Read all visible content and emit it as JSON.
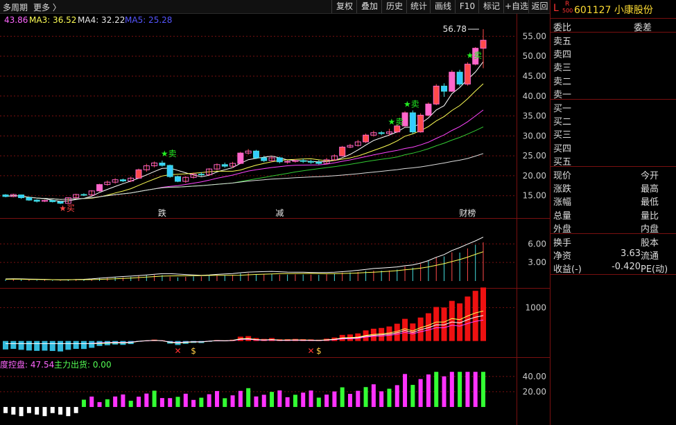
{
  "toolbar": {
    "period": "多周期",
    "more": "更多 〉",
    "buttons": [
      "复权",
      "叠加",
      "历史",
      "统计",
      "画线",
      "F10",
      "标记",
      "+自选",
      "返回"
    ]
  },
  "ma_legend": [
    {
      "label": "43.86",
      "color": "#ff66ff"
    },
    {
      "label": "MA3: 36.52",
      "color": "#ffff55"
    },
    {
      "label": "MA4: 32.22",
      "color": "#e6e6e6"
    },
    {
      "label": "MA5: 25.28",
      "color": "#5555ff"
    }
  ],
  "stock": {
    "market": "L",
    "badge_top": "R",
    "badge_bottom": "500",
    "code_name": "601127 小康股份"
  },
  "quote": {
    "header": {
      "left": "委比",
      "right": "委差"
    },
    "sells": [
      "卖五",
      "卖四",
      "卖三",
      "卖二",
      "卖一"
    ],
    "buys": [
      "买一",
      "买二",
      "买三",
      "买四",
      "买五"
    ],
    "stats": [
      {
        "l": "现价",
        "r": "今开",
        "v": ""
      },
      {
        "l": "涨跌",
        "r": "最高",
        "v": ""
      },
      {
        "l": "涨幅",
        "r": "最低",
        "v": ""
      },
      {
        "l": "总量",
        "r": "量比",
        "v": ""
      },
      {
        "l": "外盘",
        "r": "内盘",
        "v": ""
      }
    ],
    "extra": [
      {
        "l": "换手",
        "v": "",
        "r": "股本"
      },
      {
        "l": "净资",
        "v": "3.63",
        "r": "流通"
      },
      {
        "l": "收益(-)",
        "v": "-0.420",
        "r": "PE(动)"
      }
    ]
  },
  "indicator3_legend": {
    "a": "度控盘: 47.54",
    "b": "主力出货: 0.00"
  },
  "chart_data": [
    {
      "type": "candlestick",
      "yticks": [
        15.0,
        20.0,
        25.0,
        30.0,
        35.0,
        40.0,
        45.0,
        50.0,
        55.0
      ],
      "ylim": [
        12.0,
        57.5
      ],
      "max_label": "56.78",
      "annotations": [
        "跌",
        "减",
        "财榜"
      ],
      "signals": {
        "buy": "买",
        "sell": "卖"
      },
      "candles": [
        [
          15.2,
          14.8,
          15.4,
          14.6
        ],
        [
          14.8,
          15.3,
          15.5,
          14.6
        ],
        [
          15.2,
          14.5,
          15.3,
          14.2
        ],
        [
          14.5,
          13.9,
          14.7,
          13.7
        ],
        [
          13.9,
          13.6,
          14.1,
          13.3
        ],
        [
          13.6,
          13.8,
          14.0,
          13.4
        ],
        [
          13.8,
          13.5,
          14.0,
          13.3
        ],
        [
          13.5,
          13.1,
          13.7,
          12.9
        ],
        [
          13.1,
          14.5,
          14.6,
          13.0
        ],
        [
          14.5,
          15.3,
          15.5,
          14.3
        ],
        [
          15.3,
          15.2,
          15.6,
          14.9
        ],
        [
          15.2,
          16.2,
          16.4,
          15.0
        ],
        [
          16.2,
          17.8,
          18.0,
          16.0
        ],
        [
          17.8,
          18.4,
          18.8,
          17.5
        ],
        [
          18.4,
          19.0,
          19.4,
          18.0
        ],
        [
          19.0,
          18.7,
          19.3,
          18.4
        ],
        [
          18.7,
          19.4,
          19.8,
          18.4
        ],
        [
          19.4,
          21.5,
          21.8,
          19.2
        ],
        [
          21.5,
          22.5,
          23.0,
          21.0
        ],
        [
          22.5,
          23.2,
          23.6,
          22.1
        ],
        [
          23.2,
          22.6,
          23.8,
          22.3
        ],
        [
          22.6,
          19.8,
          22.8,
          19.5
        ],
        [
          19.8,
          18.6,
          20.0,
          18.4
        ],
        [
          18.6,
          19.6,
          19.9,
          18.2
        ],
        [
          19.6,
          20.4,
          20.8,
          19.3
        ],
        [
          20.4,
          20.3,
          20.9,
          19.9
        ],
        [
          20.3,
          21.7,
          21.9,
          20.0
        ],
        [
          21.7,
          22.8,
          23.1,
          21.4
        ],
        [
          22.8,
          22.4,
          23.3,
          22.0
        ],
        [
          22.4,
          23.1,
          23.5,
          22.0
        ],
        [
          23.1,
          25.7,
          26.0,
          22.9
        ],
        [
          25.7,
          26.2,
          26.7,
          25.3
        ],
        [
          26.2,
          24.5,
          26.5,
          24.2
        ],
        [
          24.5,
          23.8,
          25.0,
          23.4
        ],
        [
          23.8,
          24.5,
          24.9,
          23.4
        ],
        [
          24.5,
          23.5,
          24.8,
          23.1
        ],
        [
          23.5,
          23.6,
          23.9,
          23.0
        ],
        [
          23.6,
          23.8,
          24.2,
          23.3
        ],
        [
          23.8,
          23.6,
          24.3,
          23.2
        ],
        [
          23.6,
          23.4,
          24.0,
          23.0
        ],
        [
          23.4,
          23.1,
          23.9,
          22.8
        ],
        [
          23.1,
          24.0,
          24.5,
          22.9
        ],
        [
          24.0,
          25.0,
          25.4,
          23.7
        ],
        [
          25.0,
          27.2,
          27.5,
          24.8
        ],
        [
          27.2,
          27.6,
          28.0,
          26.9
        ],
        [
          27.6,
          28.5,
          29.0,
          27.3
        ],
        [
          28.5,
          30.2,
          30.6,
          28.2
        ],
        [
          30.2,
          30.8,
          31.3,
          29.8
        ],
        [
          30.8,
          30.6,
          31.2,
          30.2
        ],
        [
          30.6,
          31.0,
          31.8,
          30.2
        ],
        [
          31.0,
          32.5,
          33.0,
          30.7
        ],
        [
          32.5,
          35.8,
          36.2,
          32.3
        ],
        [
          35.8,
          31.0,
          36.4,
          30.5
        ],
        [
          31.0,
          35.2,
          35.7,
          30.8
        ],
        [
          35.2,
          38.0,
          38.4,
          34.9
        ],
        [
          38.0,
          42.5,
          43.0,
          37.7
        ],
        [
          42.5,
          41.2,
          43.2,
          39.8
        ],
        [
          41.2,
          46.0,
          46.5,
          41.0
        ],
        [
          46.0,
          43.0,
          46.6,
          42.5
        ],
        [
          43.0,
          48.0,
          48.5,
          42.6
        ],
        [
          48.0,
          52.0,
          52.3,
          47.7
        ],
        [
          52.0,
          54.0,
          56.78,
          47.0
        ]
      ]
    },
    {
      "type": "bar+line",
      "yticks": [
        3.0,
        6.0
      ],
      "ylim": [
        0,
        8.5
      ]
    },
    {
      "type": "bar+line",
      "yticks": [
        1000
      ],
      "ylim": [
        -400,
        1400
      ]
    },
    {
      "type": "bar",
      "yticks": [
        20.0,
        40.0
      ],
      "ylim": [
        -20,
        48
      ]
    }
  ]
}
